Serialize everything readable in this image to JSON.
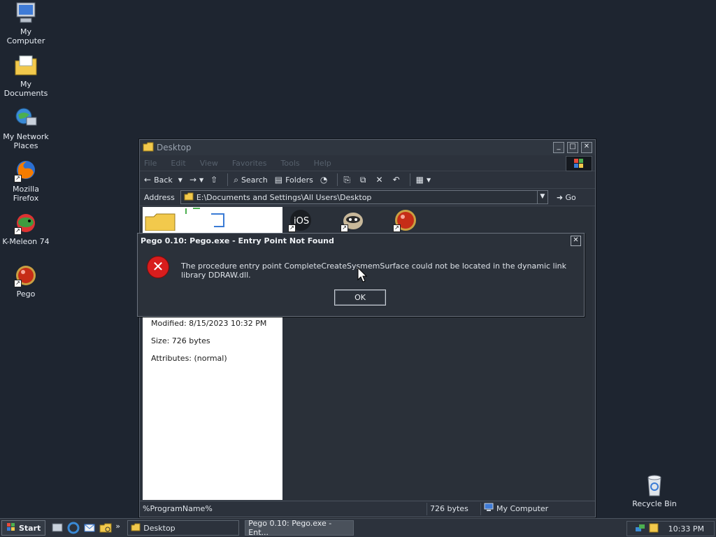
{
  "desktop": {
    "icons": [
      {
        "label": "My Computer",
        "icon": "computer-icon"
      },
      {
        "label": "My Documents",
        "icon": "documents-folder-icon"
      },
      {
        "label": "My Network Places",
        "icon": "network-places-icon"
      },
      {
        "label": "Mozilla Firefox",
        "icon": "firefox-icon"
      },
      {
        "label": "K-Meleon 74",
        "icon": "kmeleon-icon"
      },
      {
        "label": "Pego",
        "icon": "pego-icon"
      },
      {
        "label": "Recycle Bin",
        "icon": "recycle-bin-icon"
      }
    ]
  },
  "explorer": {
    "title": "Desktop",
    "menu": [
      "File",
      "Edit",
      "View",
      "Favorites",
      "Tools",
      "Help"
    ],
    "toolbar": {
      "back": "Back",
      "search": "Search",
      "folders": "Folders"
    },
    "address_label": "Address",
    "address_value": "E:\\Documents and Settings\\All Users\\Desktop",
    "go_label": "Go",
    "details": {
      "modified": "Modified: 8/15/2023 10:32 PM",
      "size": "Size: 726 bytes",
      "attributes": "Attributes: (normal)"
    },
    "file_icons": [
      {
        "label": "iOS"
      }
    ],
    "status": {
      "name": "%ProgramName%",
      "size": "726 bytes",
      "zone": "My Computer"
    }
  },
  "dialog": {
    "title": "Pego 0.10: Pego.exe - Entry Point Not Found",
    "message": "The procedure entry point CompleteCreateSysmemSurface could not be located in the dynamic link library DDRAW.dll.",
    "ok_label": "OK"
  },
  "taskbar": {
    "start_label": "Start",
    "tasks": [
      {
        "label": "Desktop"
      },
      {
        "label": "Pego 0.10: Pego.exe - Ent..."
      }
    ],
    "clock": "10:33 PM"
  },
  "colors": {
    "error_red": "#d81d1d",
    "desktop_bg": "#1e2530"
  }
}
